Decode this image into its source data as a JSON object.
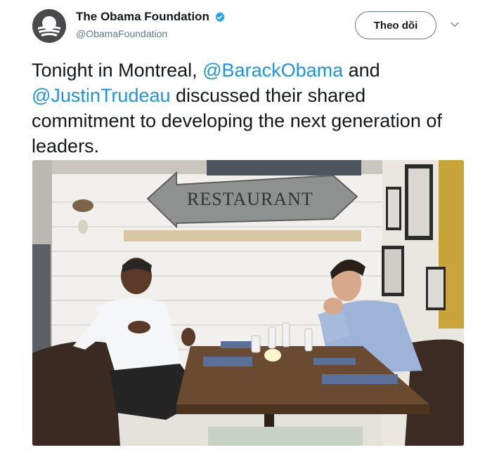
{
  "account": {
    "display_name": "The Obama Foundation",
    "handle": "@ObamaFoundation",
    "verified": true,
    "avatar_icon": "obama-foundation-logo-icon"
  },
  "actions": {
    "follow_label": "Theo dõi",
    "more_icon": "chevron-down-icon"
  },
  "tweet": {
    "text_prefix": "Tonight in Montreal, ",
    "mention1": "@BarackObama",
    "text_mid": " and ",
    "mention2": "@JustinTrudeau",
    "text_suffix": " discussed their shared commitment to developing the next generation of leaders."
  },
  "photo": {
    "sign_text": "RESTAURANT"
  },
  "colors": {
    "link": "#1b95e0",
    "verified": "#1da1f2",
    "text": "#14171a",
    "secondary": "#657786"
  }
}
